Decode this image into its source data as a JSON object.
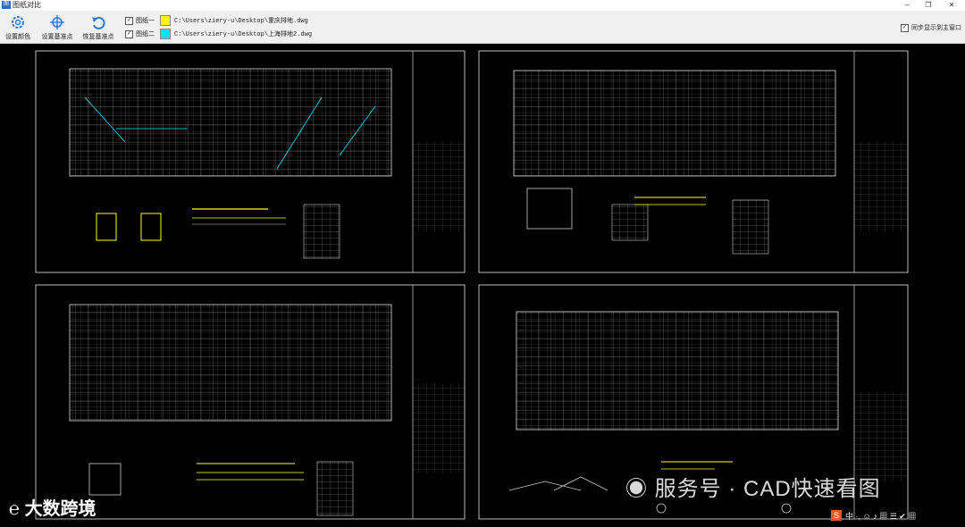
{
  "window": {
    "title": "图纸对比",
    "icon": "app-icon",
    "controls": {
      "minimize": "–",
      "maximize": "❐",
      "close": "✕"
    }
  },
  "toolbar": {
    "set_color": "设置颜色",
    "set_base": "设置基准点",
    "restore_base": "恢复基准点",
    "drawings": [
      {
        "label": "图纸一",
        "checked": true,
        "color": "#ffff00",
        "path": "C:\\Users\\ziery-u\\Desktop\\重庆排地.dwg"
      },
      {
        "label": "图纸二",
        "checked": true,
        "color": "#00e5ff",
        "path": "C:\\Users\\ziery-u\\Desktop\\上海排地2.dwg"
      }
    ],
    "sync_label": "同步显示到主窗口",
    "sync_checked": true
  },
  "overlay": {
    "watermark": "服务号 · CAD快速看图",
    "brand": "大数跨境",
    "taskbar_s": "S",
    "taskbar_text": "中 ·, ☺ ♪ ▦ ☰ ✔ ▦"
  }
}
